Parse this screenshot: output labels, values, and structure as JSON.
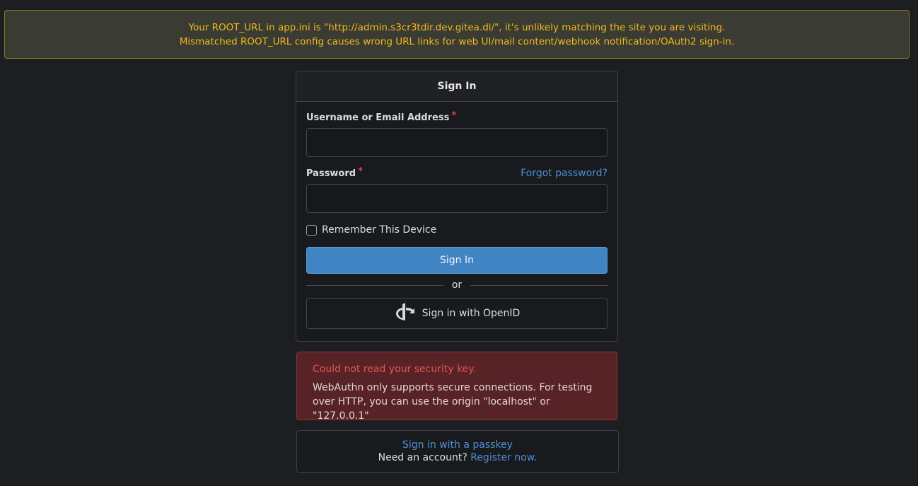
{
  "banner": {
    "line1": "Your ROOT_URL in app.ini is \"http://admin.s3cr3tdir.dev.gitea.dl/\", it's unlikely matching the site you are visiting.",
    "line2": "Mismatched ROOT_URL config causes wrong URL links for web UI/mail content/webhook notification/OAuth2 sign-in."
  },
  "signin": {
    "title": "Sign In",
    "username_label": "Username or Email Address",
    "password_label": "Password",
    "required_mark": "*",
    "username_value": "",
    "password_value": "",
    "forgot_link": "Forgot password?",
    "remember_label": "Remember This Device",
    "remember_checked": false,
    "submit_label": "Sign In",
    "divider_text": "or",
    "openid_label": "Sign in with OpenID"
  },
  "error": {
    "title": "Could not read your security key.",
    "message": "WebAuthn only supports secure connections. For testing over HTTP, you can use the origin \"localhost\" or \"127.0.0.1\""
  },
  "passkey": {
    "link": "Sign in with a passkey",
    "need_account": "Need an account?",
    "register_link": "Register now."
  },
  "colors": {
    "background": "#1c1e22",
    "primary": "#4184c4",
    "link": "#4c8fd6",
    "warning_text": "#f2b91d",
    "error_bg": "#572326"
  }
}
